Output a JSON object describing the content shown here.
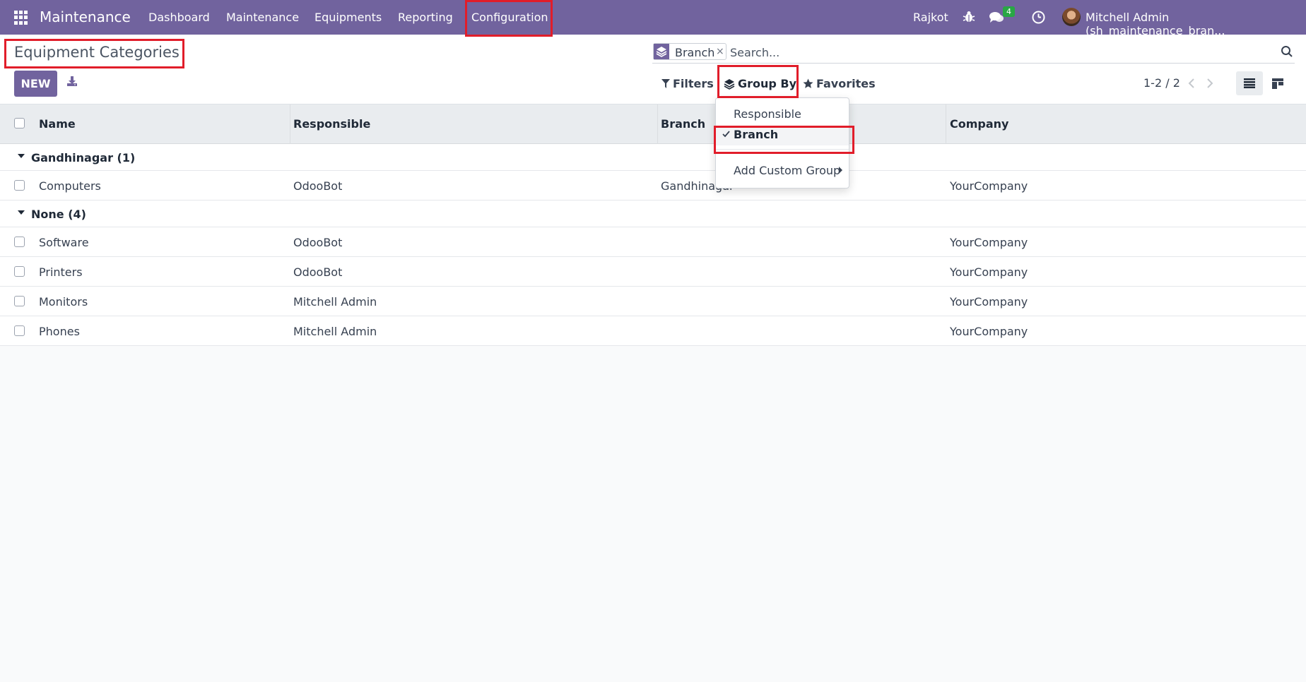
{
  "navbar": {
    "app_name": "Maintenance",
    "menu": [
      "Dashboard",
      "Maintenance",
      "Equipments",
      "Reporting",
      "Configuration"
    ],
    "branch": "Rajkot",
    "messages_count": "4",
    "user": "Mitchell Admin (sh_maintenance_bran..."
  },
  "control": {
    "title": "Equipment Categories",
    "new_label": "NEW",
    "facet_label": "Branch",
    "facet_remove": "×",
    "search_placeholder": "Search...",
    "filters_label": "Filters",
    "groupby_label": "Group By",
    "favorites_label": "Favorites",
    "pager": "1-2 / 2"
  },
  "groupby_menu": {
    "items": [
      "Responsible",
      "Branch"
    ],
    "selected": "Branch",
    "custom_label": "Add Custom Group"
  },
  "table": {
    "columns": [
      "Name",
      "Responsible",
      "Branch",
      "Company"
    ],
    "groups": [
      {
        "label": "Gandhinagar (1)",
        "rows": [
          {
            "name": "Computers",
            "responsible": "OdooBot",
            "branch": "Gandhinagar",
            "company": "YourCompany"
          }
        ]
      },
      {
        "label": "None (4)",
        "rows": [
          {
            "name": "Software",
            "responsible": "OdooBot",
            "branch": "",
            "company": "YourCompany"
          },
          {
            "name": "Printers",
            "responsible": "OdooBot",
            "branch": "",
            "company": "YourCompany"
          },
          {
            "name": "Monitors",
            "responsible": "Mitchell Admin",
            "branch": "",
            "company": "YourCompany"
          },
          {
            "name": "Phones",
            "responsible": "Mitchell Admin",
            "branch": "",
            "company": "YourCompany"
          }
        ]
      }
    ]
  },
  "colors": {
    "brand": "#71639e",
    "highlight": "#e11d2a",
    "badge": "#28a745"
  }
}
